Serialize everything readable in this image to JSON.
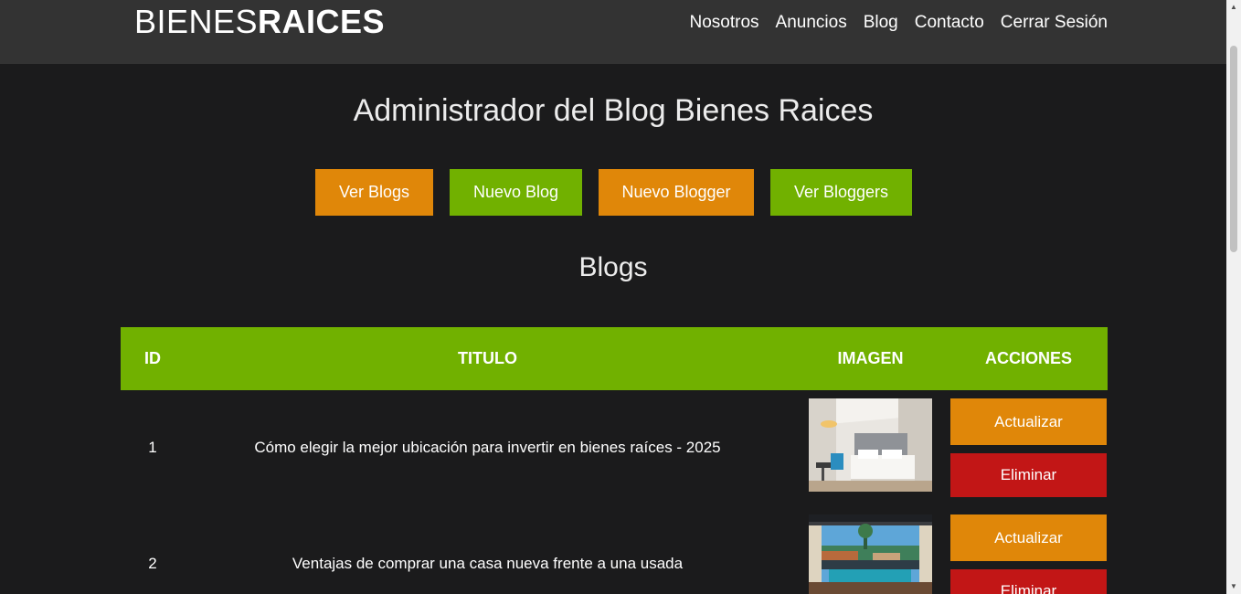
{
  "header": {
    "logo_light": "BIENES",
    "logo_bold": "RAICES",
    "nav": [
      "Nosotros",
      "Anuncios",
      "Blog",
      "Contacto",
      "Cerrar Sesión"
    ]
  },
  "main": {
    "title": "Administrador del Blog Bienes Raices",
    "buttons": [
      "Ver Blogs",
      "Nuevo Blog",
      "Nuevo Blogger",
      "Ver Bloggers"
    ],
    "section_title": "Blogs"
  },
  "table": {
    "headers": [
      "ID",
      "TITULO",
      "IMAGEN",
      "ACCIONES"
    ],
    "rows": [
      {
        "id": "1",
        "title": "Cómo elegir la mejor ubicación para invertir en bienes raíces - 2025"
      },
      {
        "id": "2",
        "title": "Ventajas de comprar una casa nueva frente a una usada"
      }
    ],
    "update_label": "Actualizar",
    "delete_label": "Eliminar"
  },
  "colors": {
    "background": "#1b1b1c",
    "header": "#333333",
    "green": "#71b100",
    "orange": "#e08709",
    "red": "#c21616"
  },
  "icons": {
    "scroll_up": "scroll-up-arrow-icon",
    "scroll_down": "scroll-down-arrow-icon"
  }
}
